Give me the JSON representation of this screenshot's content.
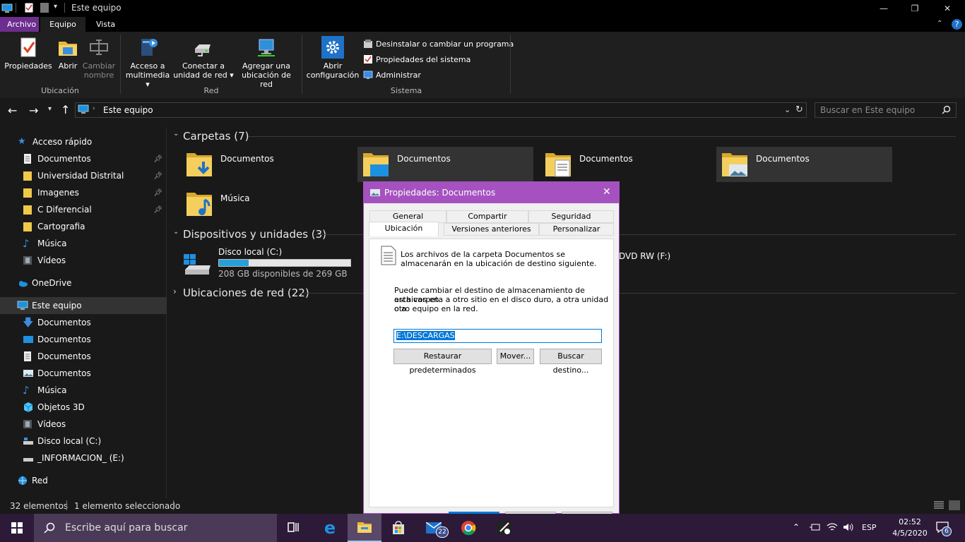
{
  "window": {
    "title": "Este equipo",
    "controls": {
      "minimize": "—",
      "maximize": "❐",
      "close": "✕"
    }
  },
  "ribbon_tabs": [
    "Archivo",
    "Equipo",
    "Vista"
  ],
  "ribbon": {
    "ubicacion": {
      "label": "Ubicación",
      "buttons": [
        {
          "label1": "Propiedades",
          "label2": ""
        },
        {
          "label1": "Abrir",
          "label2": ""
        },
        {
          "label1": "Cambiar",
          "label2": "nombre"
        }
      ]
    },
    "red": {
      "label": "Red",
      "buttons": [
        {
          "label1": "Acceso a",
          "label2": "multimedia ▾"
        },
        {
          "label1": "Conectar a",
          "label2": "unidad de red ▾"
        },
        {
          "label1": "Agregar una",
          "label2": "ubicación de red"
        }
      ]
    },
    "sistema": {
      "label": "Sistema",
      "open_settings": {
        "label1": "Abrir",
        "label2": "configuración"
      },
      "items": [
        "Desinstalar o cambiar un programa",
        "Propiedades del sistema",
        "Administrar"
      ]
    }
  },
  "address": {
    "path": "Este equipo",
    "search_placeholder": "Buscar en Este equipo"
  },
  "sidebar": {
    "quick_access": "Acceso rápido",
    "quick_items": [
      "Documentos",
      "Universidad Distrital",
      "Imagenes",
      "C Diferencial",
      "Cartografia",
      "Música",
      "Vídeos"
    ],
    "onedrive": "OneDrive",
    "this_pc": "Este equipo",
    "pc_items": [
      "Documentos",
      "Documentos",
      "Documentos",
      "Documentos",
      "Música",
      "Objetos 3D",
      "Vídeos",
      "Disco local (C:)",
      "_INFORMACION_ (E:)"
    ],
    "network": "Red"
  },
  "content": {
    "folders_header": "Carpetas (7)",
    "folders": [
      "Documentos",
      "Documentos",
      "Documentos",
      "Documentos",
      "Música"
    ],
    "devices_header": "Dispositivos y unidades (3)",
    "disk": {
      "name": "Disco local (C:)",
      "free": "208 GB disponibles de 269 GB",
      "used_fraction": 0.227
    },
    "dvd": "DVD RW (F:)",
    "network_header": "Ubicaciones de red (22)"
  },
  "status": {
    "count": "32 elementos",
    "selected": "1 elemento seleccionado"
  },
  "dialog": {
    "title": "Propiedades: Documentos",
    "tabs_row1": [
      "General",
      "Compartir",
      "Seguridad"
    ],
    "tabs_row2": [
      "Ubicación",
      "Versiones anteriores",
      "Personalizar"
    ],
    "info_line1": "Los archivos de la carpeta Documentos se",
    "info_line2": "almacenarán en la ubicación de destino siguiente.",
    "desc_line1": "Puede cambiar el destino de almacenamiento de archivos en",
    "desc_line2": "esta carpeta a otro sitio en el disco duro, a otra unidad o a",
    "desc_line3": "otro equipo en la red.",
    "path": "E:\\DESCARGAS",
    "btn_restore": "Restaurar predeterminados",
    "btn_move": "Mover...",
    "btn_find": "Buscar destino..."
  },
  "taskbar": {
    "search_placeholder": "Escribe aquí para buscar",
    "mail_badge": "22",
    "lang": "ESP",
    "time": "02:52",
    "date": "4/5/2020",
    "notif_badge": "6"
  },
  "colors": {
    "accent": "#a552c0",
    "file_tab": "#6d2e8f",
    "progress": "#26a0da",
    "taskbar": "#2c1a38"
  }
}
